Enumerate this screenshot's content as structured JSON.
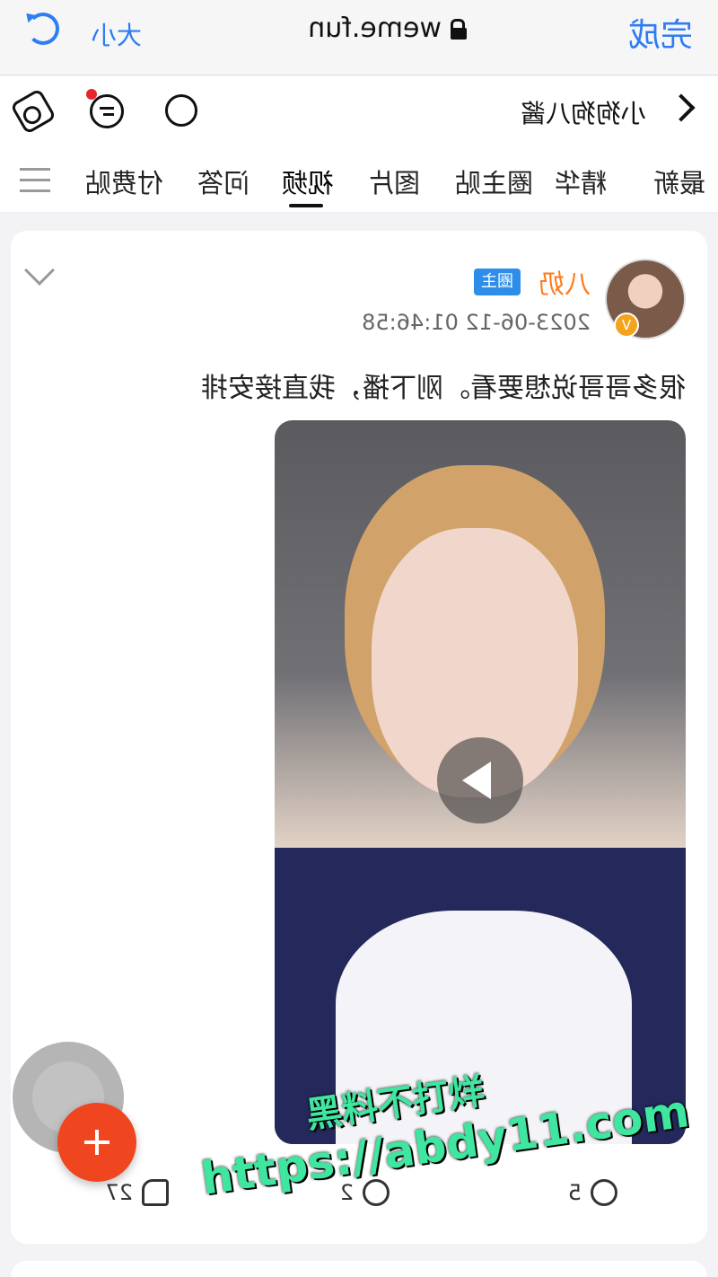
{
  "browser": {
    "done": "完成",
    "url": "weme.fun",
    "text_size": "大小"
  },
  "header": {
    "title": "小狗狗八酱"
  },
  "tabs": [
    "最新",
    "精华",
    "圈主贴",
    "图片",
    "视频",
    "问答",
    "付费贴"
  ],
  "active_tab": "视频",
  "post": {
    "author": "八奶",
    "badge": "圈主",
    "time": "2023-06-12 01:46:58",
    "text": "很多哥哥说想要看。刚下播，我直接安排",
    "shares": "5",
    "comments": "2",
    "likes": "27"
  },
  "watermark": {
    "line1": "黑料不打烊",
    "line2": "https://abdy11.com"
  },
  "colors": {
    "accent": "#2e7cf6",
    "author": "#ff7a1a",
    "badge": "#2e8de8",
    "fab": "#f0461f",
    "watermark": "#3fe6a0"
  }
}
